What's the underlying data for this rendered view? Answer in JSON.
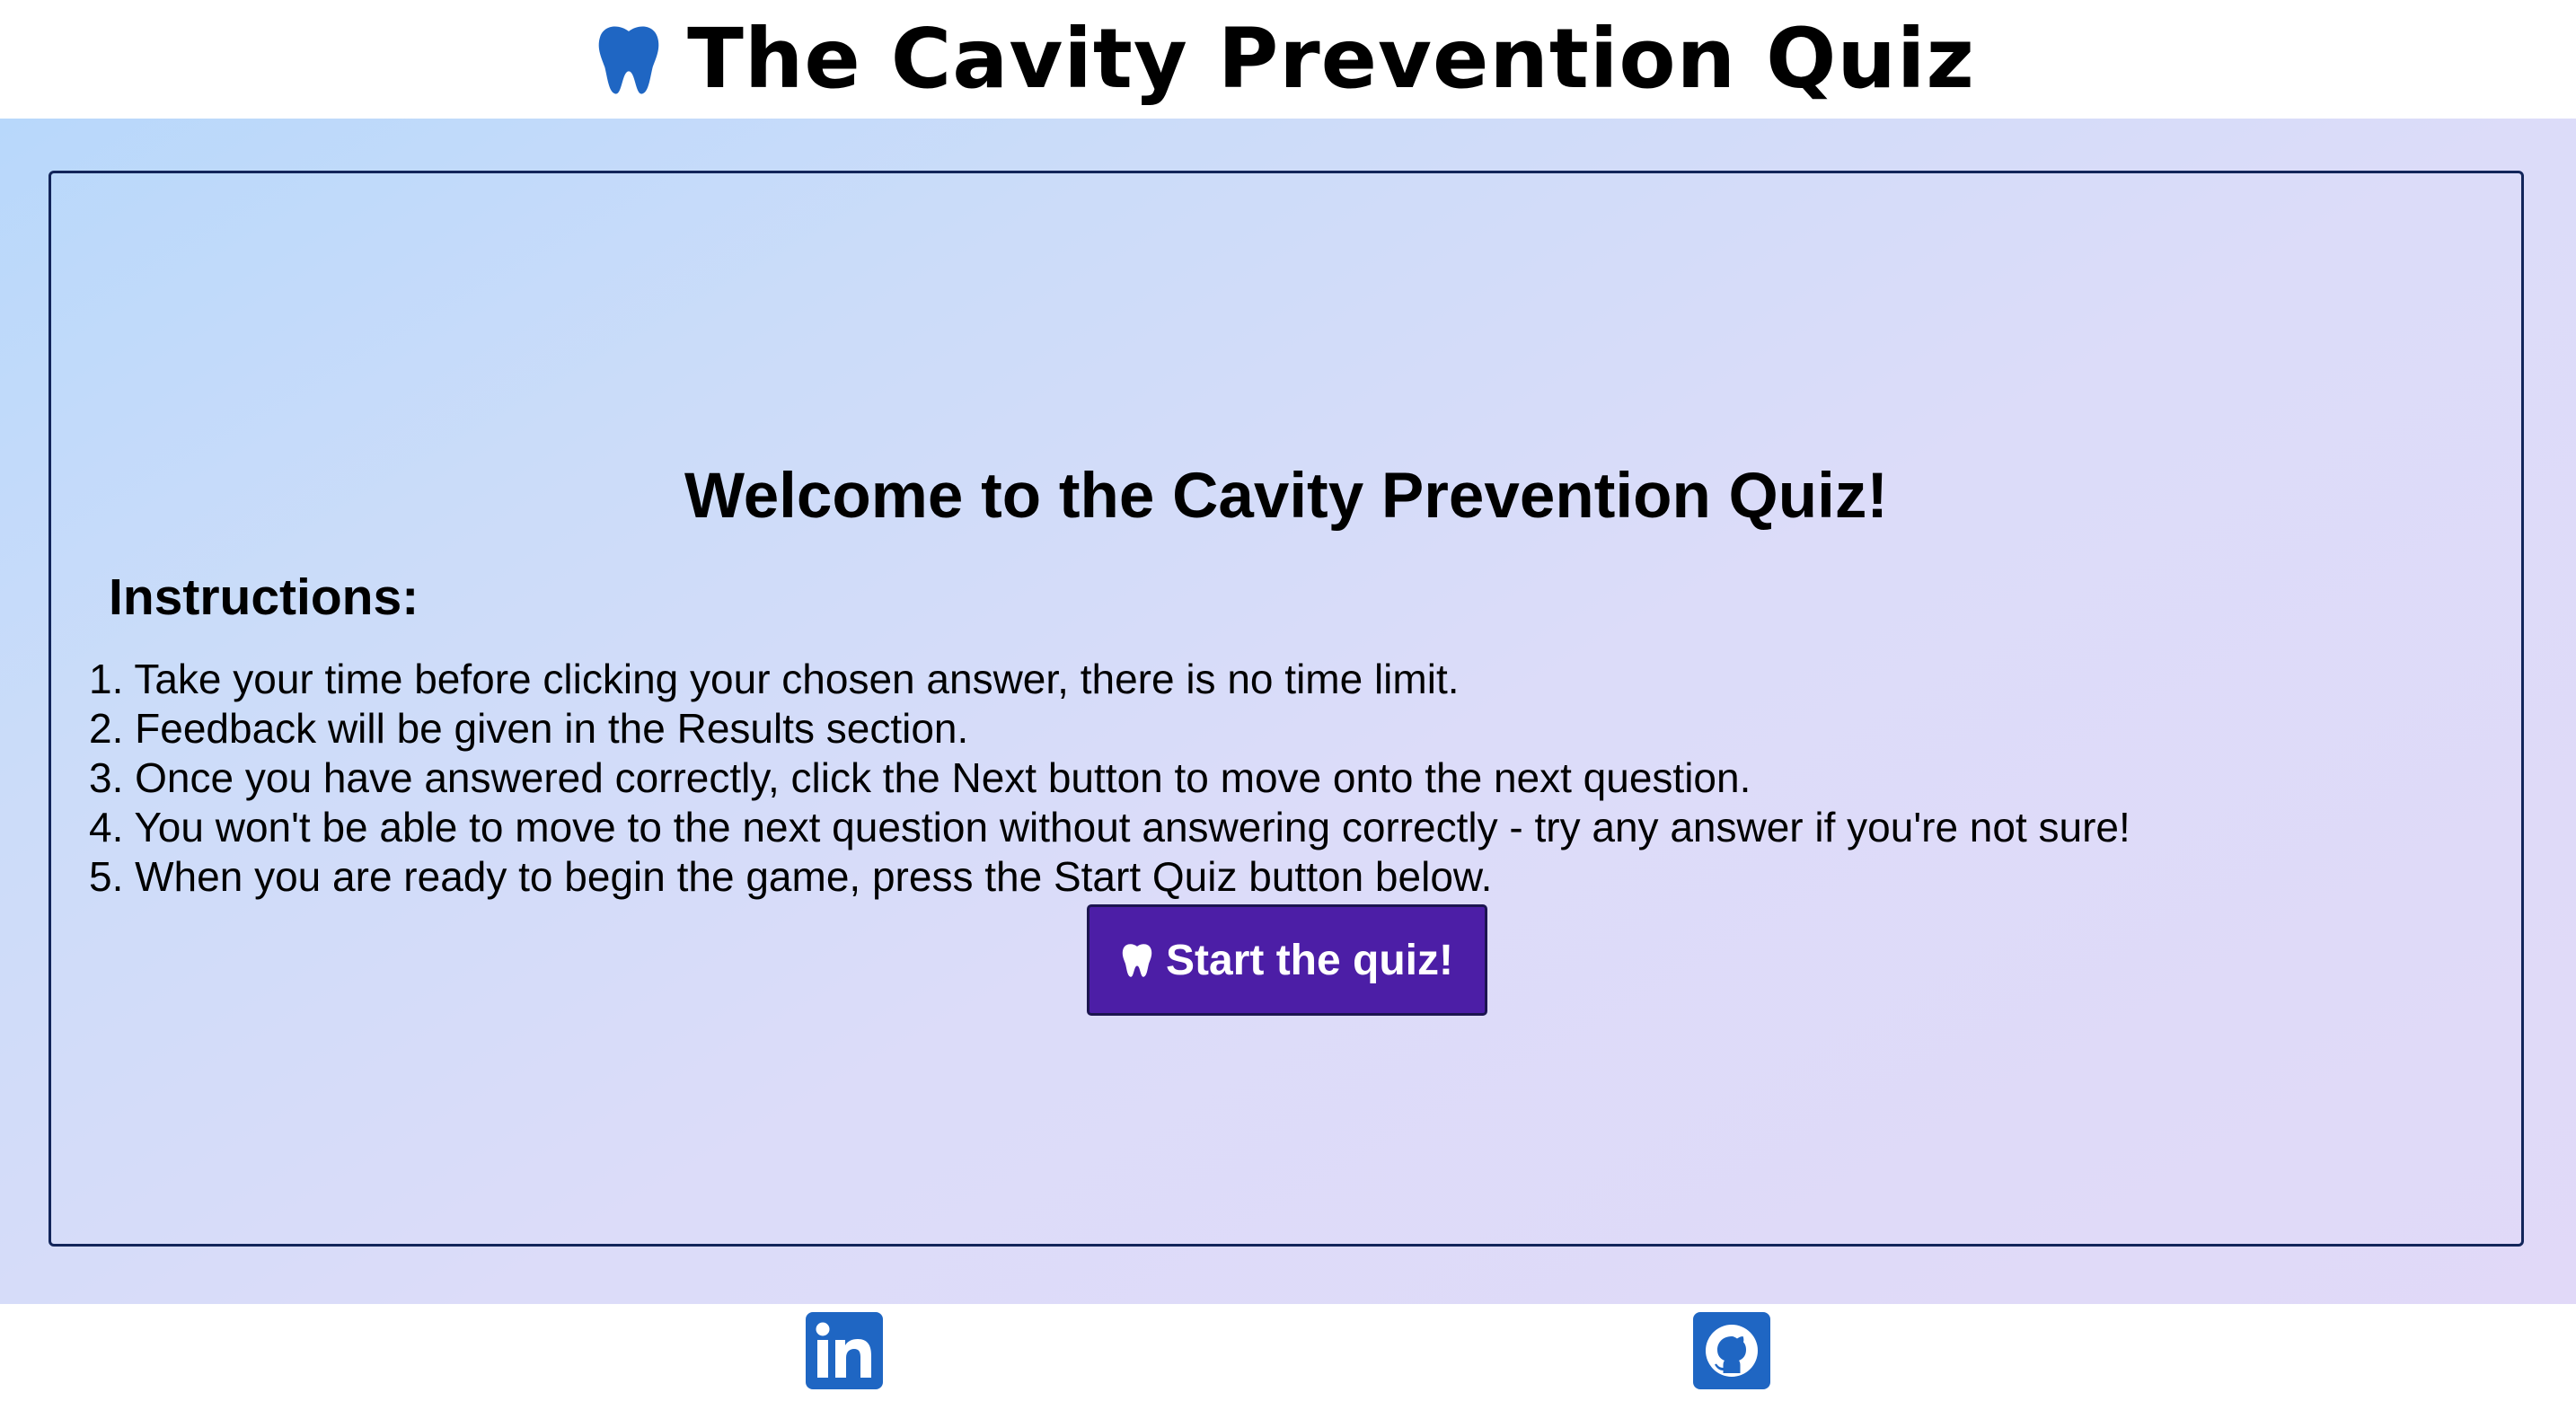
{
  "header": {
    "title": "The Cavity Prevention Quiz",
    "icon": "tooth-icon",
    "icon_color": "#1f66c3"
  },
  "main": {
    "welcome_heading": "Welcome to the Cavity Prevention Quiz!",
    "instructions_title": "Instructions:",
    "steps": [
      "1. Take your time before clicking your chosen answer, there is no time limit.",
      "2. Feedback will be given in the Results section.",
      "3. Once you have answered correctly, click the Next button to move onto the next question.",
      "4. You won't be able to move to the next question without answering correctly - try any answer if you're not sure!",
      "5. When you are ready to begin the game, press the Start Quiz button below."
    ],
    "start_button": {
      "label": "Start the quiz!",
      "icon": "tooth-icon",
      "color": "#4c1ea6"
    }
  },
  "footer": {
    "links": [
      {
        "icon": "linkedin-icon",
        "color": "#1f66c3"
      },
      {
        "icon": "github-icon",
        "color": "#1f66c3"
      }
    ]
  }
}
